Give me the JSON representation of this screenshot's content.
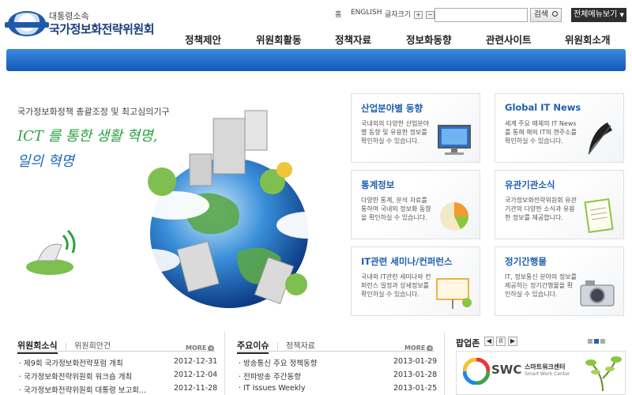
{
  "header": {
    "org_sub": "대통령소속",
    "org_name": "국가정보화전략위원회",
    "util_home": "홈",
    "util_english": "ENGLISH",
    "util_fontsize": "글자크기",
    "zoom_in": "+",
    "zoom_out": "−",
    "search_placeholder": "",
    "search_label": "검색",
    "allmenu_label": "전체메뉴보기",
    "gnb": [
      "정책제안",
      "위원회활동",
      "정책자료",
      "정보화동향",
      "관련사이트",
      "위원회소개"
    ]
  },
  "visual": {
    "subtitle": "국가정보화정책 총괄조정 및 최고심의기구",
    "slogan_line1": "ICT 를 통한 생활 혁명,",
    "slogan_line2": "일의 혁명"
  },
  "cards": [
    {
      "title": "산업분야별 동향",
      "desc": "국내외의 다양한 산업분야별 동향 및 유용한 정보를 확인하실 수 있습니다."
    },
    {
      "title": "Global IT News",
      "desc": "세계 주요 매체의 IT News를 통해 해외 IT의 현주소를 확인하실 수 있습니다."
    },
    {
      "title": "통계정보",
      "desc": "다양한 통계, 분석 자료를 통하여 국내외 정보화 동향을 확인하실 수 있습니다."
    },
    {
      "title": "유관기관소식",
      "desc": "국가정보화전략위원회 유관기관의 다양한 소식과 유용한 정보를 제공합니다."
    },
    {
      "title": "IT관련 세미나/컨퍼런스",
      "desc": "국내외 IT관련 세미나와 컨퍼런스 일정과 상세정보를 확인하실 수 있습니다."
    },
    {
      "title": "정기간행물",
      "desc": "IT, 정보통신 분야의 정보를 제공하는 정기간행물을 확인하실 수 있습니다."
    }
  ],
  "news": {
    "tab_active": "위원회소식",
    "tab_other": "위원회안건",
    "more": "MORE",
    "items": [
      {
        "title": "· 제9회 국가정보화전략포럼 개최",
        "date": "2012-12-31"
      },
      {
        "title": "· 국가정보화전략위원회 워크숍 개최",
        "date": "2012-12-04"
      },
      {
        "title": "· 국가정보화전략위원회 대통령 보고회...",
        "date": "2012-11-28"
      }
    ]
  },
  "issues": {
    "tab_active": "주요이슈",
    "tab_other": "정책자료",
    "more": "MORE",
    "items": [
      {
        "title": "· 방송통신 주요 정책동향",
        "date": "2013-01-29"
      },
      {
        "title": "· 전파방송 주간동향",
        "date": "2013-01-28"
      },
      {
        "title": "· IT Issues Weekly",
        "date": "2013-01-25"
      }
    ]
  },
  "popup": {
    "title": "팝업존",
    "nav_prev": "◀",
    "nav_pause": "II",
    "nav_next": "▶",
    "banner_logo": "SWC",
    "banner_name": "스마트워크센터",
    "banner_sub": "Smart Work Center"
  },
  "colors": {
    "brand_blue": "#1458b8",
    "slogan_green": "#2aa23f",
    "card_title": "#1f5fb0"
  }
}
